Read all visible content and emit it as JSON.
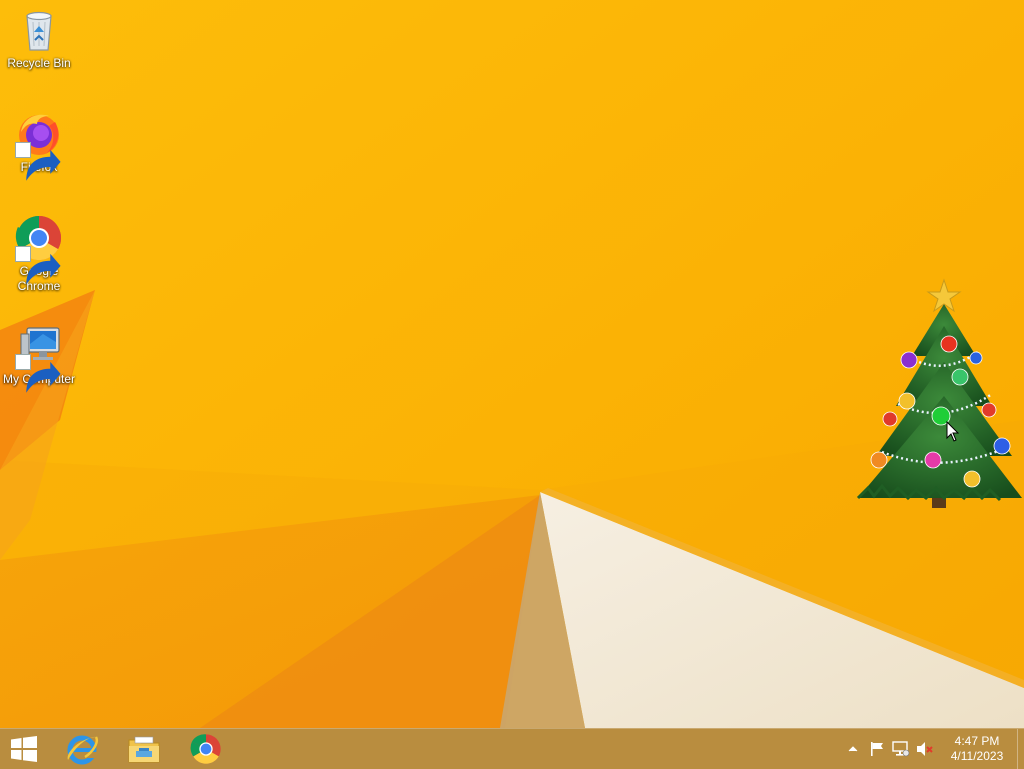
{
  "desktop": {
    "icons": [
      {
        "label": "Recycle Bin",
        "icon": "recycle-bin-icon"
      },
      {
        "label": "Firefox",
        "icon": "firefox-icon"
      },
      {
        "label": "Google Chrome",
        "icon": "chrome-icon"
      },
      {
        "label": "My Computer",
        "icon": "computer-icon"
      }
    ],
    "wallpaper_colors": {
      "primary": "#fbb605",
      "accent": "#f08a0a",
      "light": "#f3ead9"
    }
  },
  "taskbar": {
    "pinned": [
      {
        "icon": "start-button-windows-icon"
      },
      {
        "icon": "internet-explorer-icon"
      },
      {
        "icon": "file-explorer-icon"
      },
      {
        "icon": "chrome-icon"
      }
    ],
    "tray": {
      "icons": [
        "show-hidden-icons-chevron-icon",
        "action-center-flag-icon",
        "network-icon",
        "volume-muted-icon"
      ],
      "time": "4:47 PM",
      "date": "4/11/2023"
    }
  }
}
